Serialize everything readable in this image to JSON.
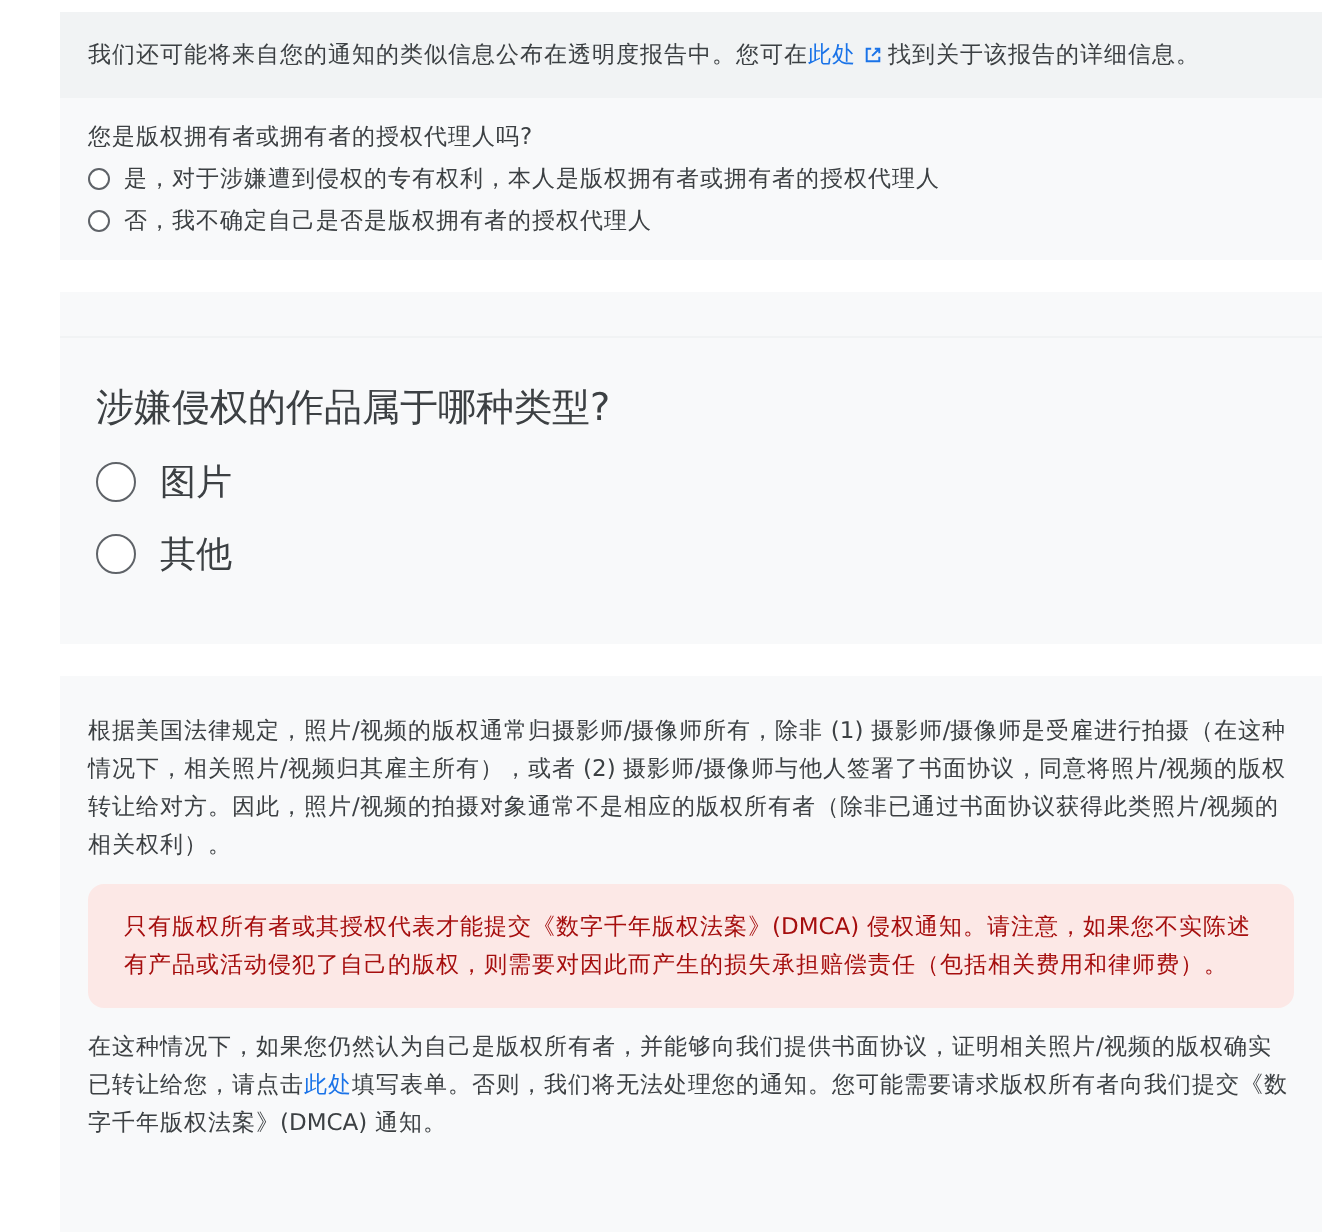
{
  "transparency_notice": {
    "before": "我们还可能将来自您的通知的类似信息公布在透明度报告中。您可在",
    "link": "此处",
    "after": "找到关于该报告的详细信息。"
  },
  "owner_question": {
    "label": "您是版权拥有者或拥有者的授权代理人吗?",
    "options": [
      {
        "label": "是，对于涉嫌遭到侵权的专有权利，本人是版权拥有者或拥有者的授权代理人",
        "selected": false
      },
      {
        "label": "否，我不确定自己是否是版权拥有者的授权代理人",
        "selected": false
      }
    ]
  },
  "work_type_question": {
    "label": "涉嫌侵权的作品属于哪种类型?",
    "options": [
      {
        "label": "图片",
        "selected": false
      },
      {
        "label": "其他",
        "selected": false
      }
    ]
  },
  "photo_section": {
    "paragraph": "根据美国法律规定，照片/视频的版权通常归摄影师/摄像师所有，除非 (1) 摄影师/摄像师是受雇进行拍摄（在这种情况下，相关照片/视频归其雇主所有），或者 (2) 摄影师/摄像师与他人签署了书面协议，同意将照片/视频的版权转让给对方。因此，照片/视频的拍摄对象通常不是相应的版权所有者（除非已通过书面协议获得此类照片/视频的相关权利）。",
    "warning": "只有版权所有者或其授权代表才能提交《数字千年版权法案》(DMCA) 侵权通知。请注意，如果您不实陈述有产品或活动侵犯了自己的版权，则需要对因此而产生的损失承担赔偿责任（包括相关费用和律师费）。",
    "closing": {
      "before": "在这种情况下，如果您仍然认为自己是版权所有者，并能够向我们提供书面协议，证明相关照片/视频的版权确实已转让给您，请点击",
      "link": "此处",
      "after": "填写表单。否则，我们将无法处理您的通知。您可能需要请求版权所有者向我们提交《数字千年版权法案》(DMCA) 通知。"
    }
  }
}
